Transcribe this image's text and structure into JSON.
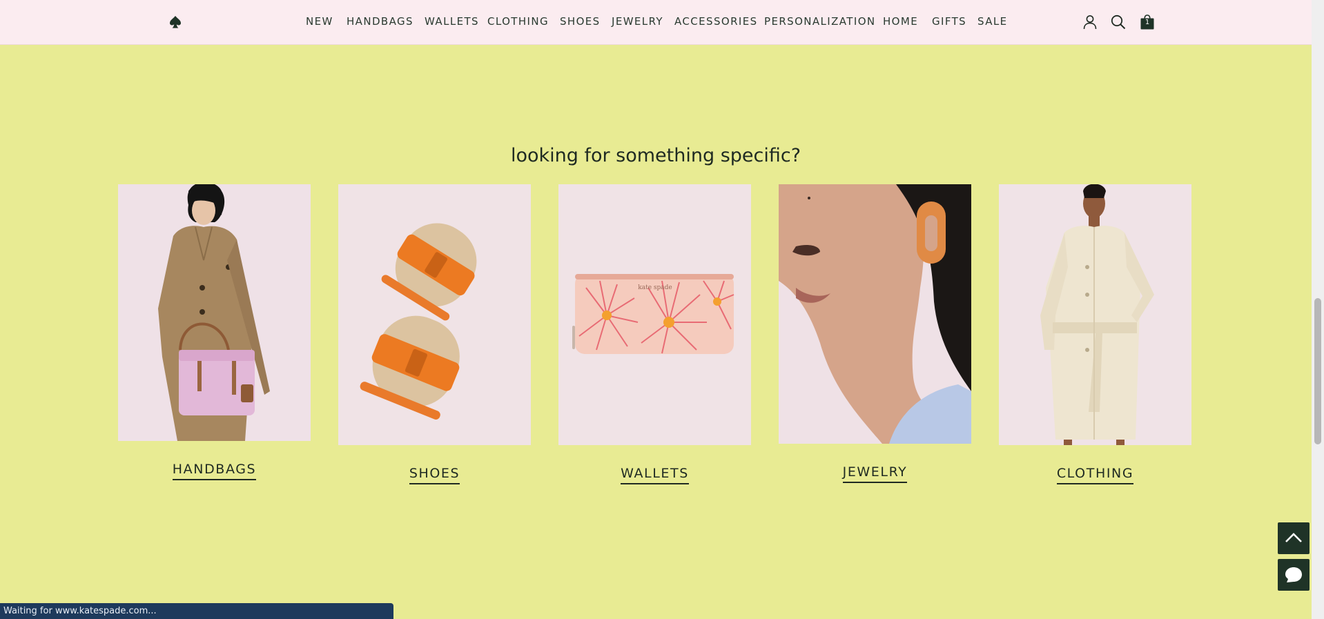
{
  "nav": {
    "items": [
      "NEW",
      "HANDBAGS",
      "WALLETS",
      "CLOTHING",
      "SHOES",
      "JEWELRY",
      "ACCESSORIES",
      "PERSONALIZATION",
      "HOME",
      "GIFTS",
      "SALE"
    ],
    "icons": [
      "spade-logo-icon",
      "account-icon",
      "search-icon",
      "shopping-bag-icon"
    ],
    "cart_count": "1"
  },
  "section": {
    "title": "looking for something specific?"
  },
  "categories": [
    {
      "label": "HANDBAGS",
      "image": "woman-with-pink-handbag-image"
    },
    {
      "label": "SHOES",
      "image": "orange-slide-sandals-image"
    },
    {
      "label": "WALLETS",
      "image": "floral-zip-wallet-image"
    },
    {
      "label": "JEWELRY",
      "image": "woman-wearing-earring-image"
    },
    {
      "label": "CLOTHING",
      "image": "woman-in-cream-coat-image"
    }
  ],
  "floating": {
    "icons": [
      "scroll-to-top-icon",
      "chat-icon"
    ]
  },
  "status_bar": {
    "text": "Waiting for www.katespade.com..."
  },
  "colors": {
    "page_background": "#e8eb93",
    "nav_background": "#fbecf0",
    "dark_green": "#1f3327",
    "status_bar": "#1e3a5c"
  }
}
